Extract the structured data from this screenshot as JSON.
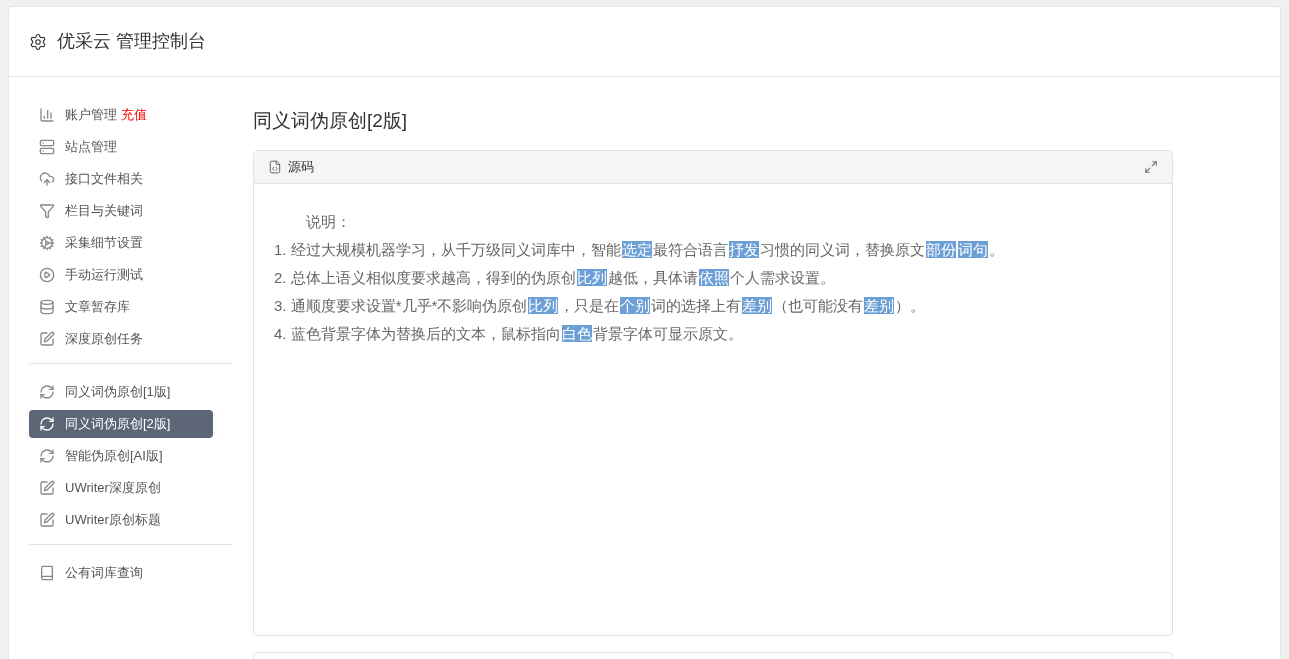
{
  "header": {
    "title": "优采云 管理控制台"
  },
  "sidebar": {
    "groups": [
      {
        "items": [
          {
            "kind": "chart",
            "label": "账户管理",
            "badge": "充值",
            "selected": false
          },
          {
            "kind": "server",
            "label": "站点管理",
            "selected": false
          },
          {
            "kind": "cloud",
            "label": "接口文件相关",
            "selected": false
          },
          {
            "kind": "filter",
            "label": "栏目与关键词",
            "selected": false
          },
          {
            "kind": "gears",
            "label": "采集细节设置",
            "selected": false
          },
          {
            "kind": "play",
            "label": "手动运行测试",
            "selected": false
          },
          {
            "kind": "database",
            "label": "文章暂存库",
            "selected": false
          },
          {
            "kind": "edit",
            "label": "深度原创任务",
            "selected": false
          }
        ]
      },
      {
        "items": [
          {
            "kind": "sync",
            "label": "同义词伪原创[1版]",
            "selected": false
          },
          {
            "kind": "sync",
            "label": "同义词伪原创[2版]",
            "selected": true
          },
          {
            "kind": "sync",
            "label": "智能伪原创[AI版]",
            "selected": false
          },
          {
            "kind": "edit",
            "label": "UWriter深度原创",
            "selected": false
          },
          {
            "kind": "edit",
            "label": "UWriter原创标题",
            "selected": false
          }
        ]
      },
      {
        "items": [
          {
            "kind": "book",
            "label": "公有词库查询",
            "selected": false
          }
        ]
      }
    ]
  },
  "main": {
    "title": "同义词伪原创[2版]",
    "editor": {
      "toolbar_label": "源码",
      "heading": "说明：",
      "lines": [
        [
          {
            "text": "1. 经过大规模机器学习，从千万级同义词库中，智能",
            "highlighted": false
          },
          {
            "text": "选定",
            "highlighted": true
          },
          {
            "text": "最符合语言",
            "highlighted": false
          },
          {
            "text": "抒发",
            "highlighted": true
          },
          {
            "text": "习惯的同义词，替换原文",
            "highlighted": false
          },
          {
            "text": "部份",
            "highlighted": true
          },
          {
            "text": "词句",
            "highlighted": true
          },
          {
            "text": "。",
            "highlighted": false
          }
        ],
        [
          {
            "text": "2. 总体上语义相似度要求越高，得到的伪原创",
            "highlighted": false
          },
          {
            "text": "比列",
            "highlighted": true
          },
          {
            "text": "越低，具体请",
            "highlighted": false
          },
          {
            "text": "依照",
            "highlighted": true
          },
          {
            "text": "个人需求设置。",
            "highlighted": false
          }
        ],
        [
          {
            "text": "3. 通顺度要求设置*几乎*不影响伪原创",
            "highlighted": false
          },
          {
            "text": "比列",
            "highlighted": true
          },
          {
            "text": "，只是在",
            "highlighted": false
          },
          {
            "text": "个别",
            "highlighted": true
          },
          {
            "text": "词的选择上有",
            "highlighted": false
          },
          {
            "text": "差别",
            "highlighted": true
          },
          {
            "text": "（也可能没有",
            "highlighted": false
          },
          {
            "text": "差别",
            "highlighted": true
          },
          {
            "text": "）。",
            "highlighted": false
          }
        ],
        [
          {
            "text": "4. 蓝色背景字体为替换后的文本，鼠标指向",
            "highlighted": false
          },
          {
            "text": "白色",
            "highlighted": true
          },
          {
            "text": "背景字体可显示原文。",
            "highlighted": false
          }
        ]
      ]
    }
  }
}
